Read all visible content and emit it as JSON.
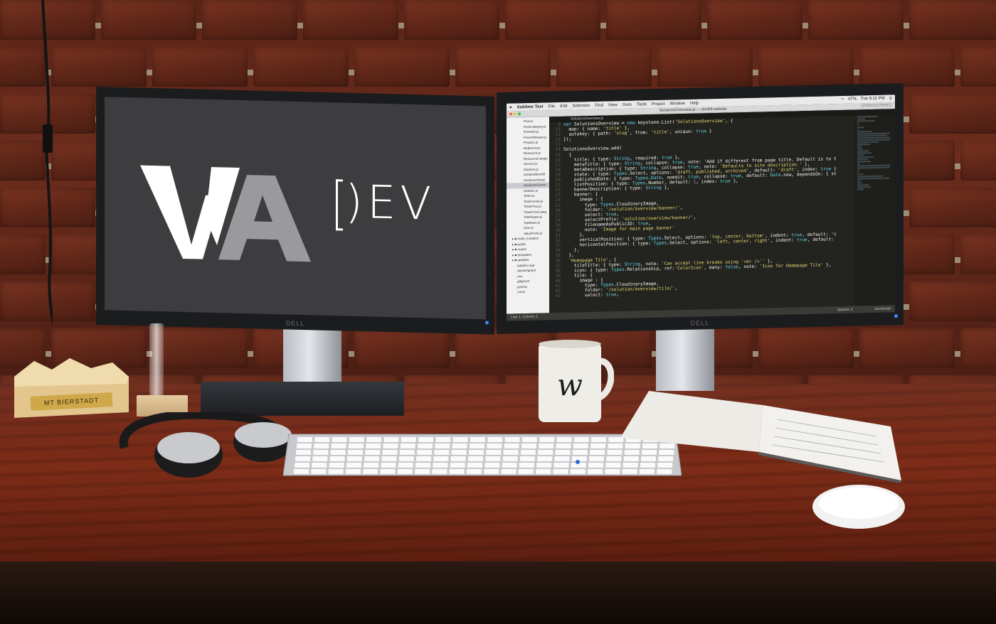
{
  "scene": {
    "description_tag": "desk with dual monitors",
    "colors": {
      "wall_brick": "#5e2618",
      "desk_wood": "#7d2c17",
      "screen_left_bg": "#3d3d3f",
      "code_bg": "#23241f"
    }
  },
  "left_monitor": {
    "logo_mark": "WA",
    "logo_text": ")EV",
    "logo_bracket": "[",
    "brand": "DELL"
  },
  "right_monitor": {
    "brand": "DELL",
    "menubar": {
      "apple": "",
      "app_name": "Sublime Text",
      "items": [
        "File",
        "Edit",
        "Selection",
        "Find",
        "View",
        "Goto",
        "Tools",
        "Project",
        "Window",
        "Help"
      ],
      "battery": "47%",
      "clock": "Tue 6:11 PM"
    },
    "titlebar": {
      "title": "SolutionsOverview.js — tendril-website",
      "unregistered": "UNREGISTERED"
    },
    "tab": "SolutionsOverview.js",
    "sidebar_files": [
      "Post.js",
      "PostCategory.js",
      "PressKit.js",
      "PressRelease.js",
      "Product.js",
      "Redirects.js",
      "Resource.js",
      "ResourceCatego",
      "Service.js",
      "Solution.js",
      "SolutionBenefit",
      "SolutionsDetail",
      "SolutionsOvervi",
      "Statistic.js",
      "Team.js",
      "Testimonial.js",
      "ThankYou.js",
      "ThankYouCateg",
      "TitleFlipper.js",
      "TopNews.js",
      "User.js",
      "ValuePoint.js"
    ],
    "sidebar_dirs": [
      "node_modules",
      "public",
      "routes",
      "templates",
      "updates"
    ],
    "sidebar_dotfiles": [
      ".babelrc.swp",
      ".dockerignore",
      ".env",
      ".gitignore",
      ".jshintrc",
      ".rvmrc"
    ],
    "line_numbers": [
      "9",
      "10",
      "11",
      "12",
      "13",
      "14",
      "15",
      "16",
      "17",
      "18",
      "19",
      "20",
      "21",
      "22",
      "23",
      "24",
      "25",
      "26",
      "27",
      "28",
      "29",
      "30",
      "31",
      "32",
      "33",
      "34",
      "35",
      "36",
      "37",
      "38",
      "39",
      "40",
      "41",
      "42",
      "43"
    ],
    "code_lines": [
      "var SolutionsOverview = new keystone.List('SolutionsOverview', {",
      "  map: { name: 'title' },",
      "  autokey: { path: 'slug', from: 'title', unique: true }",
      "});",
      "",
      "SolutionsOverview.add(",
      "  {",
      "    title: { type: String, required: true },",
      "    metaTitle: { type: String, collapse: true, note: 'Add if different from page title. Default is to t",
      "    metaDescription: { type: String, collapse: true, note: 'Defaults to site description.' },",
      "    state: { type: Types.Select, options: 'draft, published, archived', default: 'draft', index: true }",
      "    publishedDate: { type: Types.Date, noedit: true, collapse: true, default: Date.now, dependsOn: { st",
      "    listPosition: { type: Types.Number, default: 1, index: true },",
      "    bannerDescription: { type: String },",
      "    banner: {",
      "      image : {",
      "        type: Types.CloudinaryImage,",
      "        folder: '/solution/overview/banner/',",
      "        select: true,",
      "        selectPrefix: 'solution/overview/banner/',",
      "        filenameAsPublicID: true,",
      "        note: 'Image for main page banner'",
      "      },",
      "      verticalPosition: { type: Types.Select, options: 'top, center, bottom', indent: true, default: 'c",
      "      horizontalPosition: { type: Types.Select, options: 'left, center, right', indent: true, default:",
      "    },",
      "  },",
      "  'Homepage Tile', {",
      "    tileTitle: { type: String, note: 'Can accept line breaks using `<br />`' },",
      "    icon: { type: Types.Relationship, ref:'ColorIcon', many: false, note: 'Icon for Homepage Tile' },",
      "    tile: {",
      "      image : {",
      "        type: Types.CloudinaryImage,",
      "        folder: '/solution/overview/tile/',",
      "        select: true,"
    ],
    "status_left": "Line 1, Column 1",
    "status_spaces": "Spaces: 2",
    "status_syntax": "JavaScript"
  },
  "desk_items": {
    "plaque_text": "MT BIERSTADT",
    "mug_letter": "w"
  }
}
